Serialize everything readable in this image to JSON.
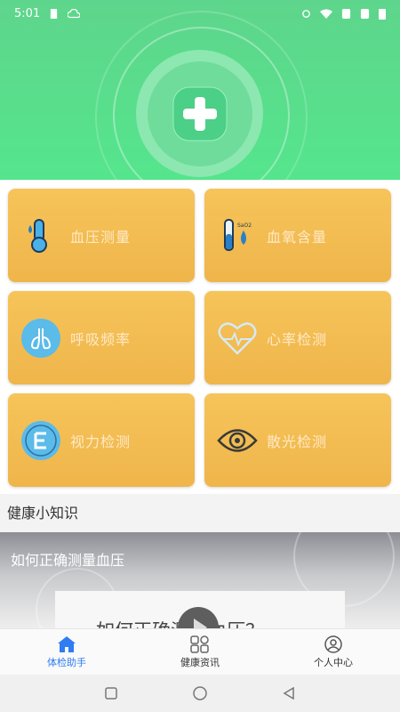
{
  "status_bar": {
    "time": "5:01"
  },
  "header": {
    "logo_icon": "medical-cross-icon"
  },
  "cards": [
    {
      "label": "血压测量",
      "icon": "thermometer-drop-icon"
    },
    {
      "label": "血氧含量",
      "icon": "test-tube-drop-icon"
    },
    {
      "label": "呼吸频率",
      "icon": "lungs-icon"
    },
    {
      "label": "心率检测",
      "icon": "heart-pulse-icon"
    },
    {
      "label": "视力检测",
      "icon": "eye-chart-icon"
    },
    {
      "label": "散光检测",
      "icon": "eye-icon"
    }
  ],
  "section": {
    "title": "健康小知识"
  },
  "article": {
    "title": "如何正确测量血压",
    "overlay_text": "如何正确测量血压？"
  },
  "tabs": [
    {
      "label": "体检助手",
      "icon": "home-icon",
      "active": true
    },
    {
      "label": "健康资讯",
      "icon": "grid-icon",
      "active": false
    },
    {
      "label": "个人中心",
      "icon": "person-icon",
      "active": false
    }
  ],
  "colors": {
    "header_green": "#55e58d",
    "card_orange": "#f2b94f",
    "tab_active": "#2f7cf3"
  }
}
